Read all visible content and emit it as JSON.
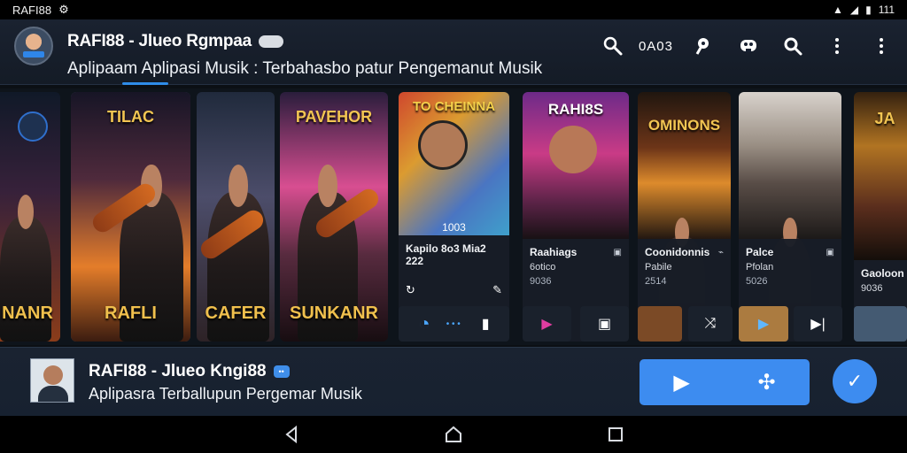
{
  "status_bar": {
    "left_text": "RAFI88",
    "right_text": "111"
  },
  "header": {
    "title": "RAFI88 - Jlueo Rgmpaa",
    "pill": "",
    "subtitle": "Aplipaam Aplipasi Musik : Terbahasbo patur Pengemanut Musik",
    "counter": "0A03"
  },
  "carousel": {
    "cards": [
      {
        "poster_title": "",
        "badge": "",
        "bottom_text": "NANR",
        "info": null
      },
      {
        "poster_title": "TILAC",
        "badge": "",
        "bottom_text": "RAFLI",
        "info": null
      },
      {
        "poster_title": "",
        "badge": "",
        "bottom_text": "CAFER",
        "info": null
      },
      {
        "poster_title": "PAVEHOR",
        "badge": "",
        "bottom_text": "SUNKANR",
        "info": null
      },
      {
        "poster_title": "TO CHEINNA",
        "badge": "",
        "bottom_text": "",
        "center_text": "1003",
        "info": {
          "title": "Kapilo 8o3 Mia2 222",
          "sub": "",
          "meta": ""
        }
      },
      {
        "poster_title": "RAHI8S",
        "badge": "",
        "bottom_text": "",
        "info": {
          "title": "Raahiags",
          "sub": "6otico",
          "meta": "9036"
        }
      },
      {
        "poster_title": "OMINONS",
        "badge": "",
        "bottom_text": "",
        "info": {
          "title": "Coonidonnis",
          "sub": "Pabile",
          "meta": "2514"
        }
      },
      {
        "poster_title": "",
        "badge": "",
        "bottom_text": "",
        "info": {
          "title": "Palce",
          "sub": "Pfolan",
          "meta": "5026"
        }
      },
      {
        "poster_title": "JA",
        "badge": "",
        "bottom_text": "",
        "info": {
          "title": "Gaoloon",
          "sub": "9036",
          "meta": ""
        }
      }
    ]
  },
  "now_playing": {
    "title": "RAFI88 - Jlueo Kngi88",
    "subtitle": "Aplipasra Terballupun Pergemar Musik"
  },
  "colors": {
    "accent": "#3d8cf0",
    "background": "#0b0f14",
    "header": "#172030"
  },
  "icons": {
    "search": "search-icon",
    "more": "more-vertical-icon",
    "play": "play-icon",
    "shuffle": "shuffle-icon",
    "check": "check-icon",
    "back": "nav-back-icon",
    "home": "nav-home-icon",
    "recents": "nav-recents-icon"
  }
}
